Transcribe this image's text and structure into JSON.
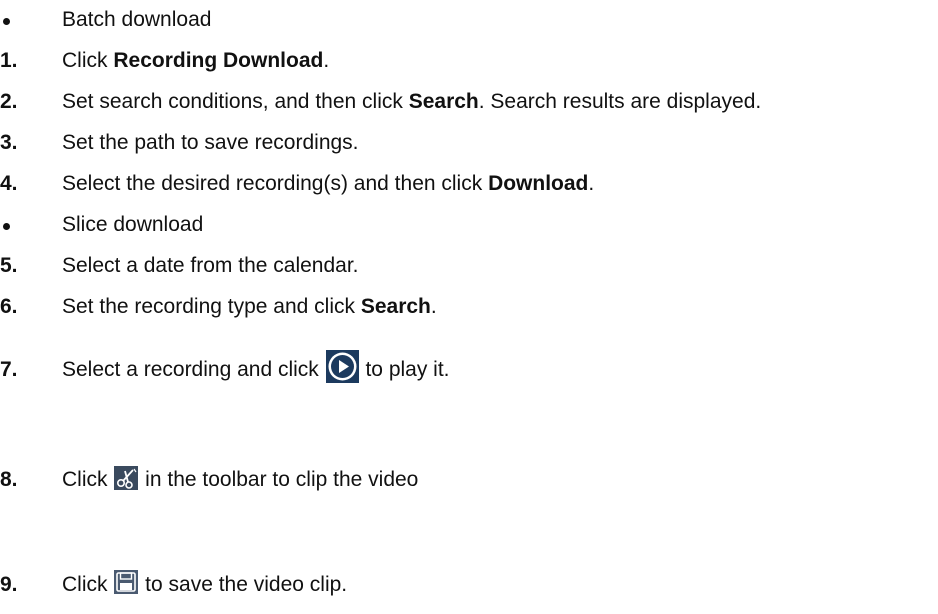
{
  "sections": {
    "batch": "Batch download",
    "slice": "Slice download"
  },
  "steps": {
    "s1": {
      "num": "1.",
      "pre": "Click ",
      "bold": "Recording Download",
      "post": "."
    },
    "s2": {
      "num": "2.",
      "pre": "Set search conditions, and then click ",
      "bold": "Search",
      "post": ". Search results are displayed."
    },
    "s3": {
      "num": "3.",
      "text": "Set the path to save recordings."
    },
    "s4": {
      "num": "4.",
      "pre": "Select the desired recording(s) and then click ",
      "bold": "Download",
      "post": "."
    },
    "s5": {
      "num": "5.",
      "text": "Select a date from the calendar."
    },
    "s6": {
      "num": "6.",
      "pre": "Set the recording type and click ",
      "bold": "Search",
      "post": "."
    },
    "s7": {
      "num": "7.",
      "pre": "Select a recording and click ",
      "post": " to play it.",
      "icon": "play-icon"
    },
    "s8": {
      "num": "8.",
      "pre": "Click ",
      "post": " in the toolbar to clip the video",
      "icon": "clip-icon"
    },
    "s9": {
      "num": "9.",
      "pre": "Click ",
      "post": " to save the video clip.",
      "icon": "save-icon"
    }
  },
  "colors": {
    "text": "#111111",
    "play_icon_bg": "#1c3a5e",
    "clip_icon_bg": "#3a4a5e",
    "save_icon_bg": "#4a5a70"
  }
}
